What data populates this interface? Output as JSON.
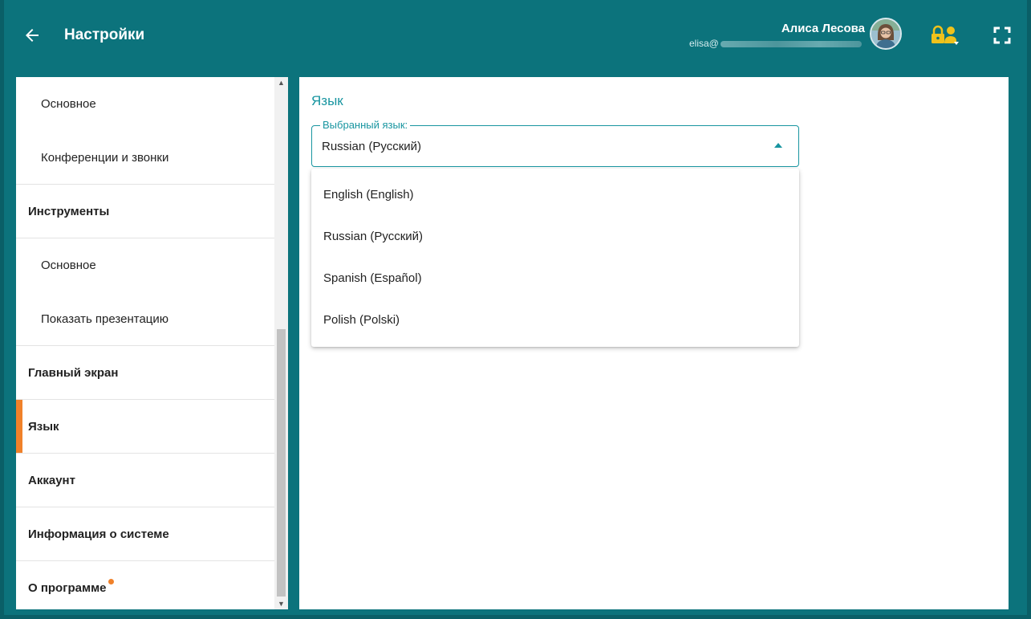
{
  "header": {
    "title": "Настройки",
    "user_name": "Алиса Лесова",
    "user_email_visible": "elisa@",
    "icons": {
      "back": "arrow-left-icon",
      "lock_user": "lock-user-icon",
      "fullscreen": "fullscreen-icon"
    },
    "colors": {
      "bar": "#0c737c",
      "lock_icon": "#f0c21b"
    }
  },
  "sidebar": {
    "items": [
      {
        "label": "Основное",
        "kind": "sub"
      },
      {
        "label": "Конференции и звонки",
        "kind": "sub"
      },
      {
        "label": "Инструменты",
        "kind": "head"
      },
      {
        "label": "Основное",
        "kind": "sub"
      },
      {
        "label": "Показать презентацию",
        "kind": "sub"
      },
      {
        "label": "Главный экран",
        "kind": "head"
      },
      {
        "label": "Язык",
        "kind": "head",
        "active": true
      },
      {
        "label": "Аккаунт",
        "kind": "head"
      },
      {
        "label": "Информация о системе",
        "kind": "head"
      },
      {
        "label": "О программе",
        "kind": "head",
        "badge": true
      }
    ],
    "colors": {
      "active_marker": "#f0812a",
      "badge": "#f0812a"
    }
  },
  "main": {
    "section_title": "Язык",
    "select": {
      "label": "Выбранный язык:",
      "value": "Russian (Русский)",
      "expanded": true
    },
    "options": [
      "English (English)",
      "Russian (Русский)",
      "Spanish (Español)",
      "Polish (Polski)"
    ],
    "colors": {
      "accent": "#1895a0"
    }
  }
}
